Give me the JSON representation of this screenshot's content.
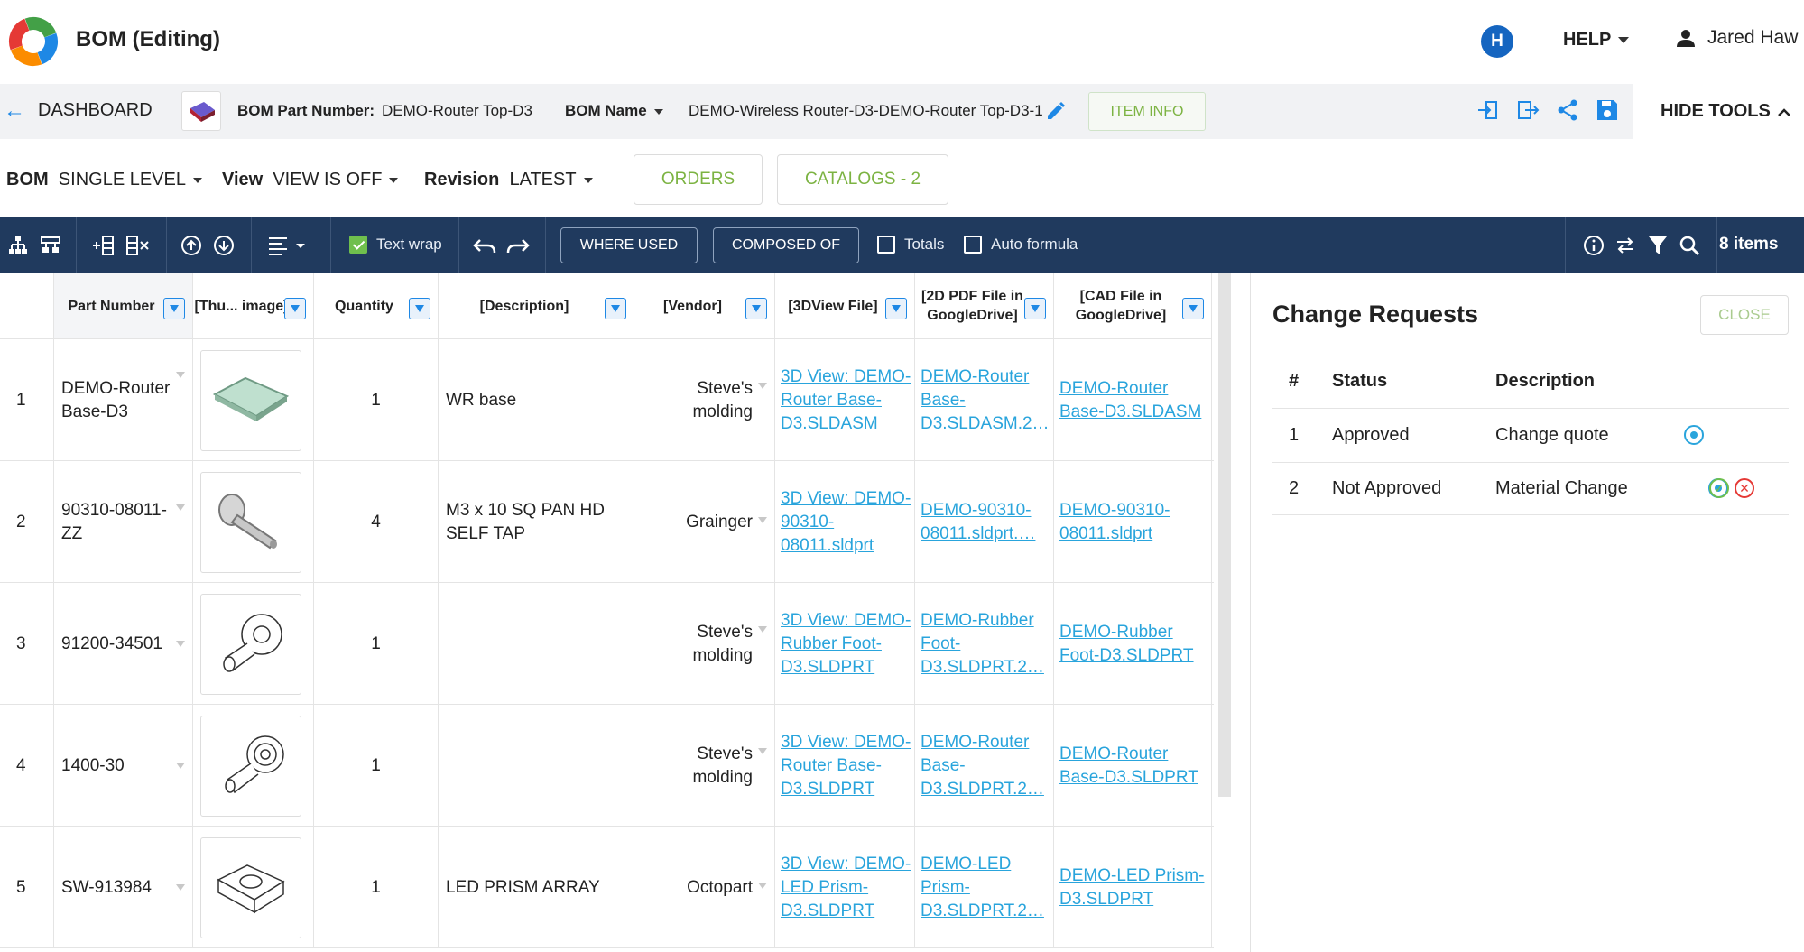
{
  "app": {
    "title": "BOM (Editing)",
    "avatar_letter": "H",
    "help_label": "HELP",
    "user_name": "Jared Haw"
  },
  "infobar": {
    "dashboard_label": "DASHBOARD",
    "part_number_label": "BOM Part Number:",
    "part_number_value": "DEMO-Router Top-D3",
    "bom_name_label": "BOM Name",
    "bom_name_value": "DEMO-Wireless Router-D3-DEMO-Router Top-D3-1",
    "item_info_label": "ITEM INFO",
    "hide_tools_label": "HIDE TOOLS"
  },
  "controls": {
    "bom_label": "BOM",
    "bom_value": "SINGLE LEVEL",
    "view_label": "View",
    "view_value": "VIEW IS OFF",
    "revision_label": "Revision",
    "revision_value": "LATEST",
    "orders_label": "ORDERS",
    "catalogs_label": "CATALOGS - 2"
  },
  "toolbar": {
    "text_wrap_label": "Text wrap",
    "where_used_label": "WHERE USED",
    "composed_of_label": "COMPOSED OF",
    "totals_label": "Totals",
    "auto_formula_label": "Auto formula",
    "items_count": "8 items"
  },
  "table": {
    "headers": [
      "Part Number",
      "[Thu... image]",
      "Quantity",
      "[Description]",
      "[Vendor]",
      "[3DView File]",
      "[2D PDF File in GoogleDrive]",
      "[CAD File in GoogleDrive]"
    ],
    "rows": [
      {
        "num": "1",
        "part": "DEMO-Router Base-D3",
        "qty": "1",
        "desc": "WR base",
        "vendor": "Steve's molding",
        "view3d": "3D View: DEMO-Router Base-D3.SLDASM",
        "pdf": "DEMO-Router Base-D3.SLDASM.2…",
        "cad": "DEMO-Router Base-D3.SLDASM"
      },
      {
        "num": "2",
        "part": "90310-08011-ZZ",
        "qty": "4",
        "desc": "M3 x 10 SQ PAN HD SELF TAP",
        "vendor": "Grainger",
        "view3d": "3D View: DEMO-90310-08011.sldprt",
        "pdf": "DEMO-90310-08011.sldprt.…",
        "cad": "DEMO-90310-08011.sldprt"
      },
      {
        "num": "3",
        "part": "91200-34501",
        "qty": "1",
        "desc": "",
        "vendor": "Steve's molding",
        "view3d": "3D View: DEMO-Rubber Foot-D3.SLDPRT",
        "pdf": "DEMO-Rubber Foot-D3.SLDPRT.2…",
        "cad": "DEMO-Rubber Foot-D3.SLDPRT"
      },
      {
        "num": "4",
        "part": "1400-30",
        "qty": "1",
        "desc": "",
        "vendor": "Steve's molding",
        "view3d": "3D View: DEMO-Router Base-D3.SLDPRT",
        "pdf": "DEMO-Router Base-D3.SLDPRT.2…",
        "cad": "DEMO-Router Base-D3.SLDPRT"
      },
      {
        "num": "5",
        "part": "SW-913984",
        "qty": "1",
        "desc": "LED PRISM ARRAY",
        "vendor": "Octopart",
        "view3d": "3D View: DEMO-LED Prism-D3.SLDPRT",
        "pdf": "DEMO-LED Prism-D3.SLDPRT.2…",
        "cad": "DEMO-LED Prism-D3.SLDPRT"
      }
    ]
  },
  "change_requests": {
    "title": "Change Requests",
    "close_label": "CLOSE",
    "headers": [
      "#",
      "Status",
      "Description"
    ],
    "rows": [
      {
        "num": "1",
        "status": "Approved",
        "description": "Change quote"
      },
      {
        "num": "2",
        "status": "Not Approved",
        "description": "Material Change"
      }
    ]
  },
  "colors": {
    "toolbar_bg": "#203a5e",
    "link": "#29a4dc",
    "accent_green": "#7cb342",
    "avatar_blue": "#1565c0"
  }
}
